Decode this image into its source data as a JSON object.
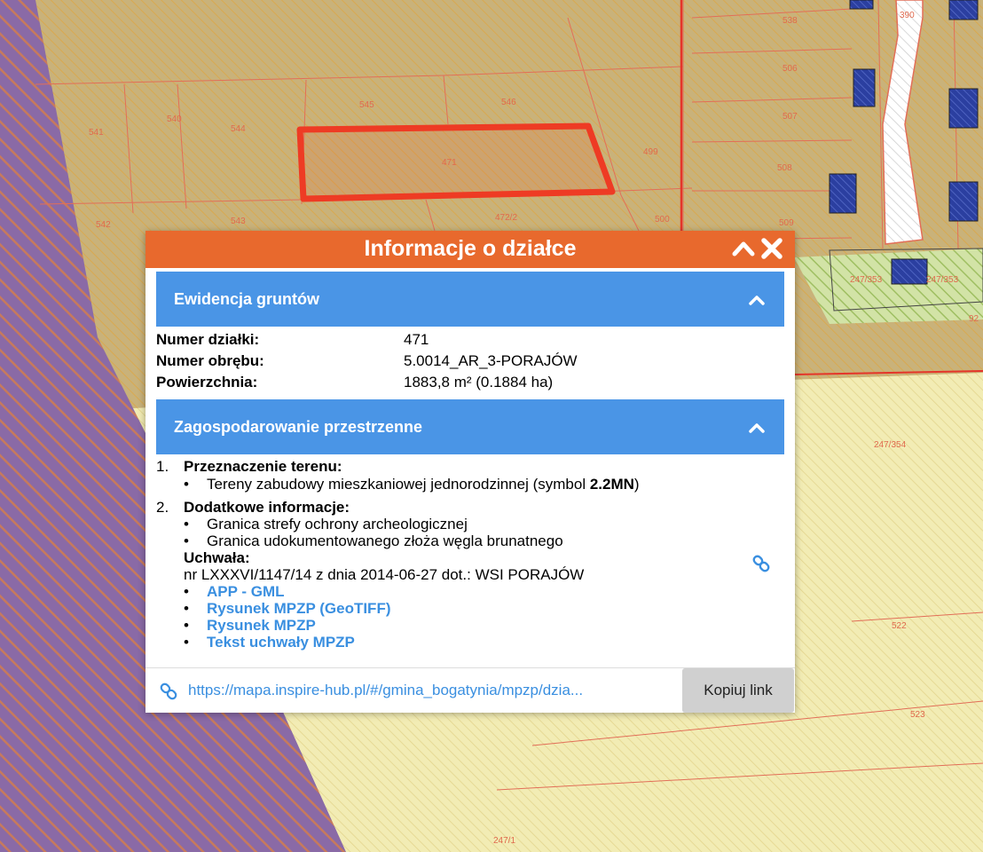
{
  "map": {
    "parcel_labels": [
      "541",
      "540",
      "544",
      "545",
      "546",
      "471",
      "499",
      "542",
      "543",
      "472/2",
      "500",
      "538",
      "506",
      "507",
      "508",
      "509",
      "390",
      "247/353",
      "247/353",
      "92",
      "247/354",
      "522",
      "523",
      "247/1"
    ],
    "colors": {
      "residential_fill": "#c9b27a",
      "purple_zone": "#8a6aa6",
      "green_zone": "#d2e3a6",
      "yellow_zone": "#f2ecb4",
      "parcel_line": "#e26e58",
      "selected_parcel": "#ee3b24",
      "building": "#2b3fa0"
    }
  },
  "popup": {
    "title": "Informacje o działce",
    "header_color": "#e8692d",
    "section_color": "#4a95e6",
    "sections": {
      "ewidencja": {
        "title": "Ewidencja gruntów",
        "rows": [
          {
            "key": "Numer działki:",
            "value": "471"
          },
          {
            "key": "Numer obrębu:",
            "value": "5.0014_AR_3-PORAJÓW"
          },
          {
            "key": "Powierzchnia:",
            "value": "1883,8 m² (0.1884 ha)"
          }
        ]
      },
      "zagospodarowanie": {
        "title": "Zagospodarowanie przestrzenne",
        "item1_num": "1.",
        "item1_head": "Przeznaczenie terenu:",
        "item1_text": "Tereny zabudowy mieszkaniowej jednorodzinnej (symbol ",
        "item1_symbol": "2.2MN",
        "item1_close": ")",
        "item2_num": "2.",
        "item2_head": "Dodatkowe informacje:",
        "item2_bullets": [
          "Granica strefy ochrony archeologicznej",
          "Granica udokumentowanego złoża węgla brunatnego"
        ],
        "uchwala_head": "Uchwała:",
        "uchwala_text": "nr LXXXVI/1147/14 z dnia 2014-06-27 dot.: WSI PORAJÓW",
        "links": [
          "APP - GML",
          "Rysunek MPZP (GeoTIFF)",
          "Rysunek MPZP",
          "Tekst uchwały MPZP"
        ]
      }
    },
    "footer": {
      "url": "https://mapa.inspire-hub.pl/#/gmina_bogatynia/mpzp/dzia...",
      "copy_label": "Kopiuj link"
    }
  }
}
